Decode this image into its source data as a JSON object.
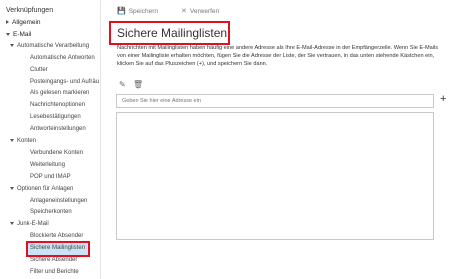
{
  "sidebar": {
    "title": "Verknüpfungen",
    "items": [
      {
        "label": "Allgemein",
        "level": 0,
        "expander": "right"
      },
      {
        "label": "E-Mail",
        "level": 0,
        "expander": "down"
      },
      {
        "label": "Automatische Verarbeitung",
        "level": 1,
        "expander": "down"
      },
      {
        "label": "Automatische Antworten",
        "level": 2
      },
      {
        "label": "Clutter",
        "level": 2
      },
      {
        "label": "Posteingangs- und Aufräu",
        "level": 2
      },
      {
        "label": "Als gelesen markieren",
        "level": 2
      },
      {
        "label": "Nachrichtenoptionen",
        "level": 2
      },
      {
        "label": "Lesebestätigungen",
        "level": 2
      },
      {
        "label": "Antworteinstellungen",
        "level": 2
      },
      {
        "label": "Konten",
        "level": 1,
        "expander": "down"
      },
      {
        "label": "Verbundene Konten",
        "level": 2
      },
      {
        "label": "Weiterleitung",
        "level": 2
      },
      {
        "label": "POP und IMAP",
        "level": 2
      },
      {
        "label": "Optionen für Anlagen",
        "level": 1,
        "expander": "down"
      },
      {
        "label": "Anlageneinstellungen",
        "level": 2
      },
      {
        "label": "Speicherkonten",
        "level": 2
      },
      {
        "label": "Junk-E-Mail",
        "level": 1,
        "expander": "down"
      },
      {
        "label": "Blockierte Absender",
        "level": 2
      },
      {
        "label": "Sichere Mailinglisten",
        "level": 2,
        "selected": true
      },
      {
        "label": "Sichere Absender",
        "level": 2
      },
      {
        "label": "Filter und Berichte",
        "level": 2
      }
    ]
  },
  "toolbar": {
    "save_label": "Speichern",
    "save_icon": "floppy-disk-icon",
    "discard_label": "Verwerfen",
    "discard_icon": "x-icon"
  },
  "main": {
    "title": "Sichere Mailinglisten",
    "description": "Nachrichten mit Mailinglisten haben häufig eine andere Adresse als Ihre E-Mail-Adresse in der Empfängerzeile. Wenn Sie E-Mails von einer Mailingliste erhalten möchten, fügen Sie die Adresse der Liste, der Sie vertrauen, in das unten stehende Kästchen ein, klicken Sie auf das Pluszeichen (+), und speichern Sie dann.",
    "edit_icon": "pencil-icon",
    "delete_icon": "trash-icon",
    "input_placeholder": "Geben Sie hier eine Adresse ein",
    "add_label": "+",
    "list_items": []
  },
  "colors": {
    "highlight_border": "#e01020",
    "selected_background": "#cce3f6"
  }
}
